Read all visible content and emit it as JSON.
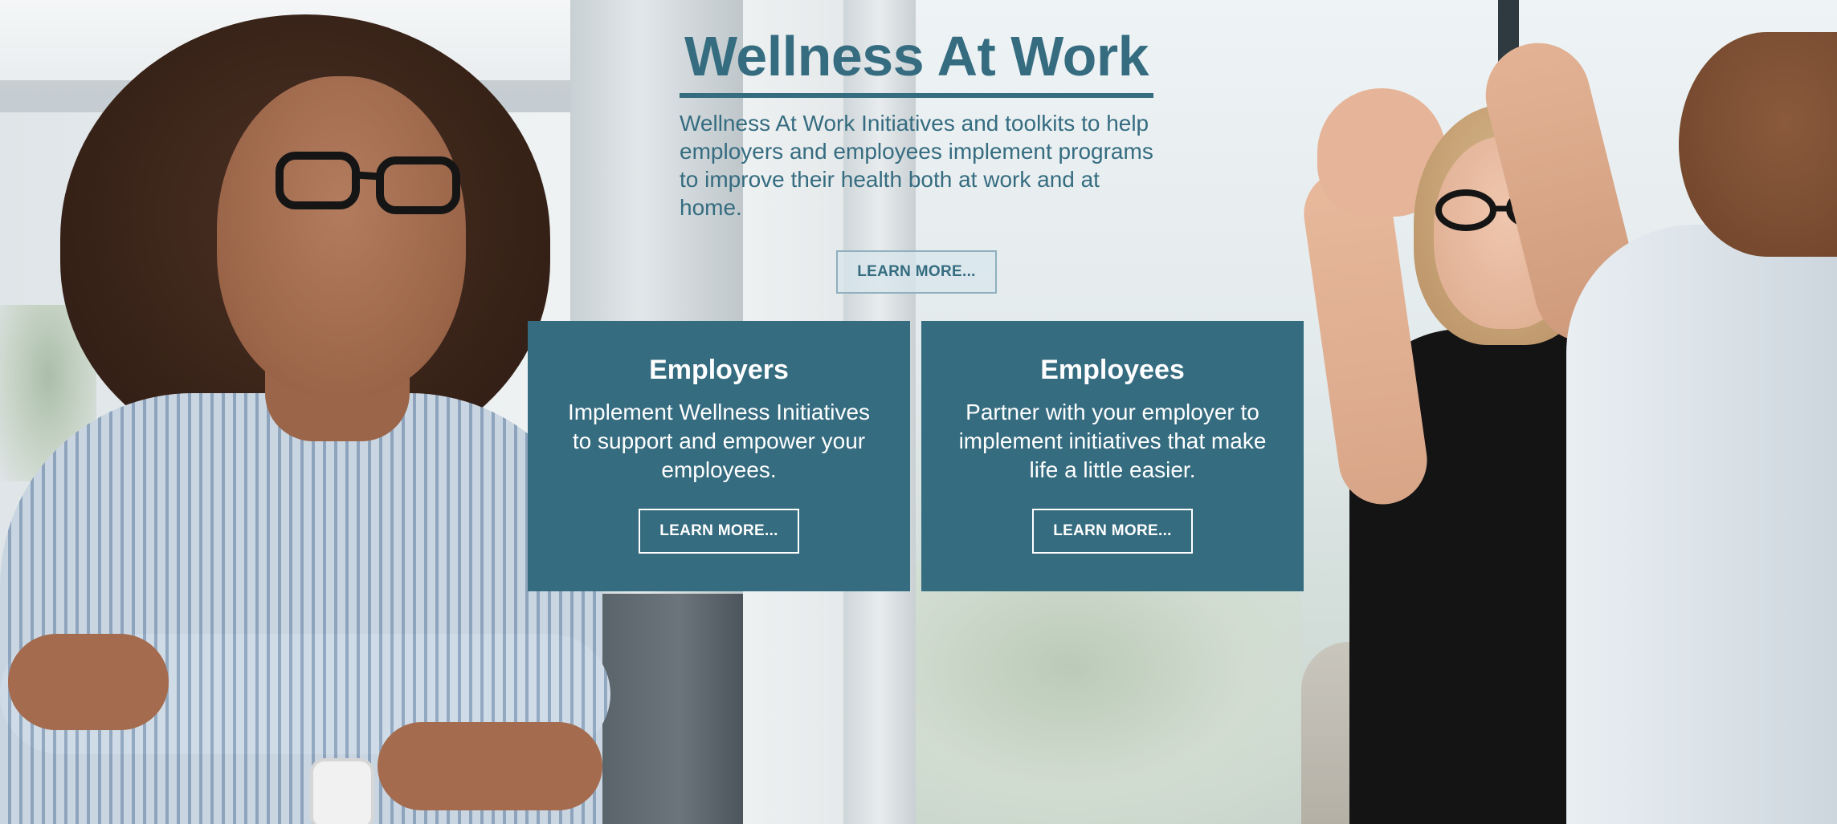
{
  "hero": {
    "title": "Wellness At Work",
    "description": "Wellness At Work Initiatives and toolkits to help employers and employees implement programs to improve their health both at work and at home.",
    "button_label": "LEARN MORE..."
  },
  "cards": [
    {
      "title": "Employers",
      "description": "Implement Wellness Initiatives to support and empower your employees.",
      "button_label": "LEARN MORE..."
    },
    {
      "title": "Employees",
      "description": "Partner with your employer to implement initiatives that make life a little easier.",
      "button_label": "LEARN MORE..."
    }
  ],
  "colors": {
    "brand": "#356c80",
    "card_text": "#ffffff",
    "hero_button_bg": "#d7e6ec"
  },
  "images": {
    "left": "smiling-woman-with-glasses-photo",
    "right": "coworkers-high-five-photo"
  }
}
